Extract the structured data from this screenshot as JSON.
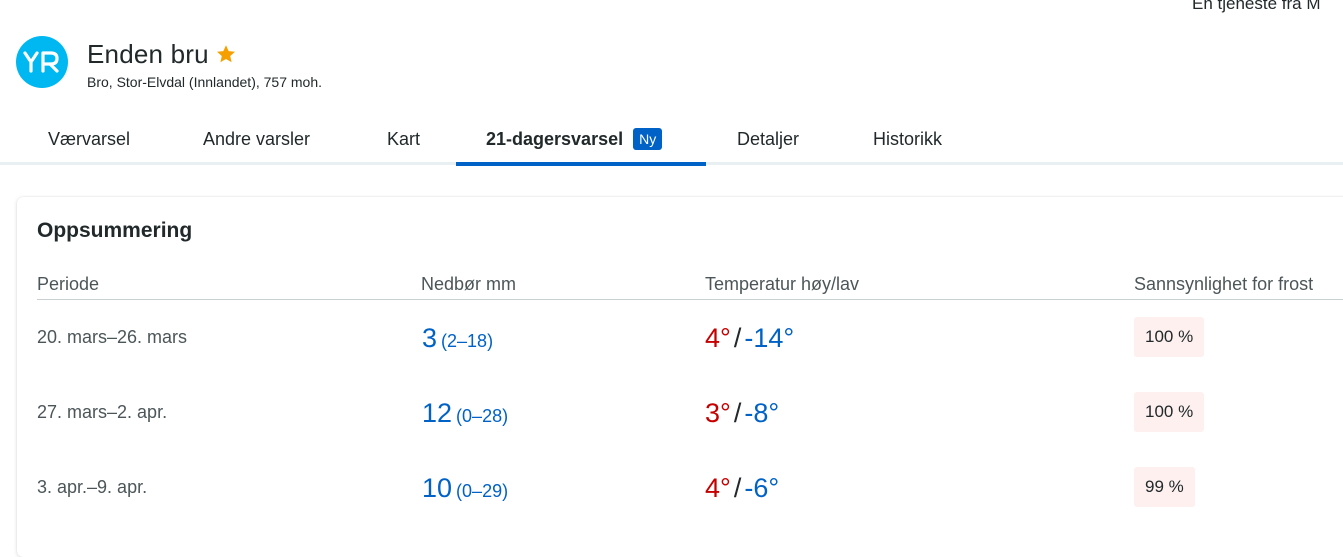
{
  "service_note": "En tjeneste fra M",
  "header": {
    "logo_text": "YR",
    "location_name": "Enden bru",
    "subtitle": "Bro, Stor-Elvdal (Innlandet), 757 moh.",
    "star_icon": "star-icon",
    "star_color": "#f5a000"
  },
  "tabs": [
    {
      "label": "Værvarsel"
    },
    {
      "label": "Andre varsler"
    },
    {
      "label": "Kart"
    },
    {
      "label": "21-dagersvarsel",
      "badge": "Ny",
      "active": true
    },
    {
      "label": "Detaljer"
    },
    {
      "label": "Historikk"
    }
  ],
  "summary": {
    "title": "Oppsummering",
    "columns": [
      "Periode",
      "Nedbør mm",
      "Temperatur høy/lav",
      "Sannsynlighet for frost"
    ],
    "rows": [
      {
        "period": "20. mars–26. mars",
        "precip": "3",
        "precip_range": "(2–18)",
        "temp_high": "4°",
        "temp_low": "-14°",
        "frost": "100 %"
      },
      {
        "period": "27. mars–2. apr.",
        "precip": "12",
        "precip_range": "(0–28)",
        "temp_high": "3°",
        "temp_low": "-8°",
        "frost": "100 %"
      },
      {
        "period": "3. apr.–9. apr.",
        "precip": "10",
        "precip_range": "(0–29)",
        "temp_high": "4°",
        "temp_low": "-6°",
        "frost": "99 %"
      }
    ]
  },
  "colors": {
    "brand": "#00b8f1",
    "accent": "#0062c6",
    "temp_high": "#c60000",
    "frost_bg": "#fdf0ef"
  }
}
